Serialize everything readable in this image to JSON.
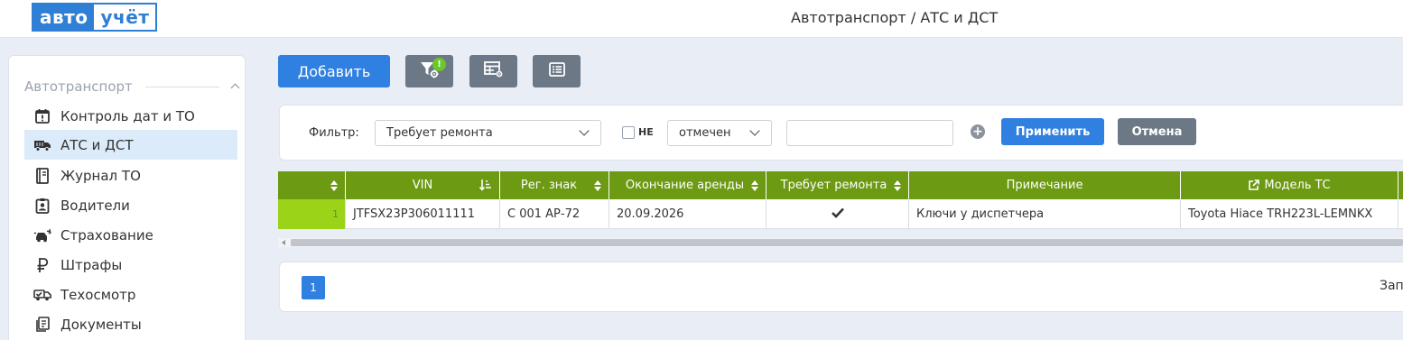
{
  "header": {
    "logo_part1": "авто",
    "logo_part2": "учёт",
    "title": "Автотранспорт / АТС и ДСТ"
  },
  "sidebar": {
    "section_label": "Автотранспорт",
    "items": [
      {
        "label": "Контроль дат и ТО",
        "icon": "calendar-alert-icon",
        "active": false
      },
      {
        "label": "АТС и ДСТ",
        "icon": "truck-icon",
        "active": true
      },
      {
        "label": "Журнал ТО",
        "icon": "logbook-icon",
        "active": false
      },
      {
        "label": "Водители",
        "icon": "id-badge-icon",
        "active": false
      },
      {
        "label": "Страхование",
        "icon": "car-crash-icon",
        "active": false
      },
      {
        "label": "Штрафы",
        "icon": "ruble-icon",
        "active": false
      },
      {
        "label": "Техосмотр",
        "icon": "truck-check-icon",
        "active": false
      },
      {
        "label": "Документы",
        "icon": "documents-icon",
        "active": false
      }
    ]
  },
  "toolbar": {
    "add_label": "Добавить",
    "filter_badge": "!",
    "icons": [
      "filter-settings-icon",
      "table-settings-icon",
      "list-view-icon"
    ]
  },
  "filter": {
    "label": "Фильтр:",
    "field_value": "Требует ремонта",
    "negate_label": "НЕ",
    "negate_checked": false,
    "condition_value": "отмечен",
    "value_input": "",
    "apply_label": "Применить",
    "cancel_label": "Отмена"
  },
  "table": {
    "columns": [
      "",
      "VIN",
      "Рег. знак",
      "Окончание аренды",
      "Требует ремонта",
      "Примечание",
      "Модель ТС"
    ],
    "rows": [
      {
        "num": "1",
        "vin": "JTFSX23P306011111",
        "reg": "С 001 АР-72",
        "lease_end": "20.09.2026",
        "needs_repair": true,
        "note": "Ключи у диспетчера",
        "model": "Toyota Hiace TRH223L-LEMNKX"
      }
    ]
  },
  "pagination": {
    "current_page": "1",
    "records_label_fragment": "Зап"
  },
  "colors": {
    "primary": "#2f80e0",
    "header_green": "#6c9a12",
    "row_number_green": "#9ad318",
    "gray_button": "#6c7885",
    "sidebar_active": "#dcebfa"
  }
}
